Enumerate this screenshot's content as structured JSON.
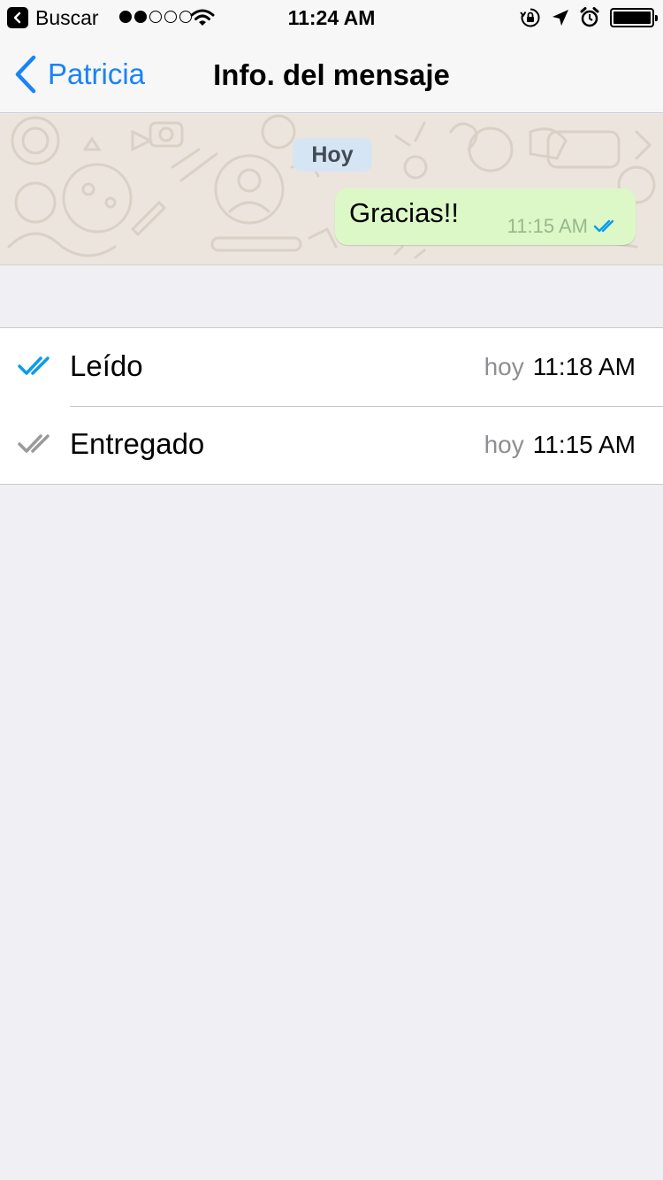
{
  "status_bar": {
    "back_app_label": "Buscar",
    "signal_bars_filled": 2,
    "signal_bars_total": 5,
    "time": "11:24 AM",
    "battery_level": 1.0,
    "icons": [
      "orientation-lock-icon",
      "location-icon",
      "alarm-icon",
      "battery-icon"
    ]
  },
  "nav": {
    "back_label": "Patricia",
    "title": "Info. del mensaje"
  },
  "chat": {
    "date_label": "Hoy",
    "message": {
      "text": "Gracias!!",
      "time": "11:15 AM",
      "status": "read"
    }
  },
  "receipts": [
    {
      "label": "Leído",
      "day": "hoy",
      "time": "11:18 AM",
      "tick_color": "#0a9bf0"
    },
    {
      "label": "Entregado",
      "day": "hoy",
      "time": "11:15 AM",
      "tick_color": "#9a9a9a"
    }
  ],
  "colors": {
    "accent": "#1a83f5",
    "bubble": "#dcf8c6",
    "chat_bg": "#ece5dd",
    "read_tick": "#0a9bf0",
    "delivered_tick": "#9a9a9a"
  }
}
